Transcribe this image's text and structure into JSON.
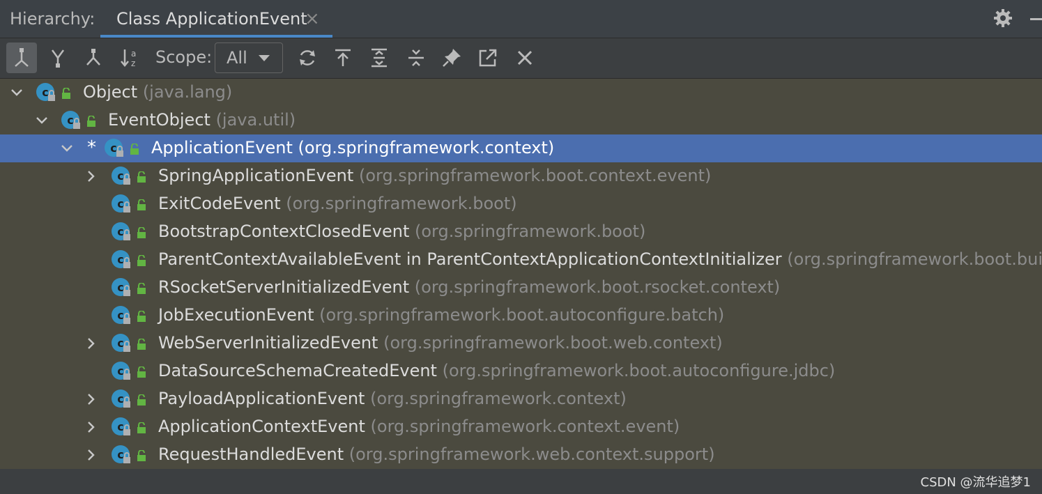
{
  "header": {
    "label": "Hierarchy:",
    "tab_label": "Class ApplicationEvent",
    "tab_close": "×",
    "settings_icon": "gear-icon",
    "minimize_icon": "minus-icon"
  },
  "toolbar": {
    "buttons": [
      {
        "icon": "type-hierarchy-icon",
        "active": true
      },
      {
        "icon": "supertypes-hierarchy-icon",
        "active": false
      },
      {
        "icon": "subtypes-hierarchy-icon",
        "active": false
      },
      {
        "icon": "sort-alphabetically-icon",
        "active": false
      }
    ],
    "scope_label": "Scope:",
    "scope_value": "All",
    "actions": [
      "refresh-icon",
      "export-icon",
      "expand-all-icon",
      "collapse-all-icon",
      "pin-icon",
      "open-in-new-icon",
      "close-icon"
    ]
  },
  "tree": {
    "rows": [
      {
        "name": "Object",
        "pkg": "(java.lang)",
        "level": 0,
        "arrow": "down",
        "selected": false
      },
      {
        "name": "EventObject",
        "pkg": "(java.util)",
        "level": 1,
        "arrow": "down",
        "selected": false
      },
      {
        "name": "ApplicationEvent",
        "pkg": "(org.springframework.context)",
        "level": 2,
        "arrow": "down",
        "selected": true,
        "star": "*"
      },
      {
        "name": "SpringApplicationEvent",
        "pkg": "(org.springframework.boot.context.event)",
        "level": 3,
        "arrow": "right",
        "selected": false
      },
      {
        "name": "ExitCodeEvent",
        "pkg": "(org.springframework.boot)",
        "level": 3,
        "arrow": "",
        "selected": false
      },
      {
        "name": "BootstrapContextClosedEvent",
        "pkg": "(org.springframework.boot)",
        "level": 3,
        "arrow": "",
        "selected": false
      },
      {
        "name": "ParentContextAvailableEvent in ParentContextApplicationContextInitializer",
        "pkg": "(org.springframework.boot.builder)",
        "level": 3,
        "arrow": "",
        "selected": false
      },
      {
        "name": "RSocketServerInitializedEvent",
        "pkg": "(org.springframework.boot.rsocket.context)",
        "level": 3,
        "arrow": "",
        "selected": false
      },
      {
        "name": "JobExecutionEvent",
        "pkg": "(org.springframework.boot.autoconfigure.batch)",
        "level": 3,
        "arrow": "",
        "selected": false
      },
      {
        "name": "WebServerInitializedEvent",
        "pkg": "(org.springframework.boot.web.context)",
        "level": 3,
        "arrow": "right",
        "selected": false
      },
      {
        "name": "DataSourceSchemaCreatedEvent",
        "pkg": "(org.springframework.boot.autoconfigure.jdbc)",
        "level": 3,
        "arrow": "",
        "selected": false
      },
      {
        "name": "PayloadApplicationEvent",
        "pkg": "(org.springframework.context)",
        "level": 3,
        "arrow": "right",
        "selected": false
      },
      {
        "name": "ApplicationContextEvent",
        "pkg": "(org.springframework.context.event)",
        "level": 3,
        "arrow": "right",
        "selected": false
      },
      {
        "name": "RequestHandledEvent",
        "pkg": "(org.springframework.web.context.support)",
        "level": 3,
        "arrow": "right",
        "selected": false
      }
    ]
  },
  "colors": {
    "tree_bg": "#4b4a3f",
    "selection": "#4b6eaf",
    "class_icon": "#3592c4",
    "lock_green": "#62b543",
    "tab_underline": "#4a88c7"
  },
  "watermark": "CSDN @流华追梦1"
}
